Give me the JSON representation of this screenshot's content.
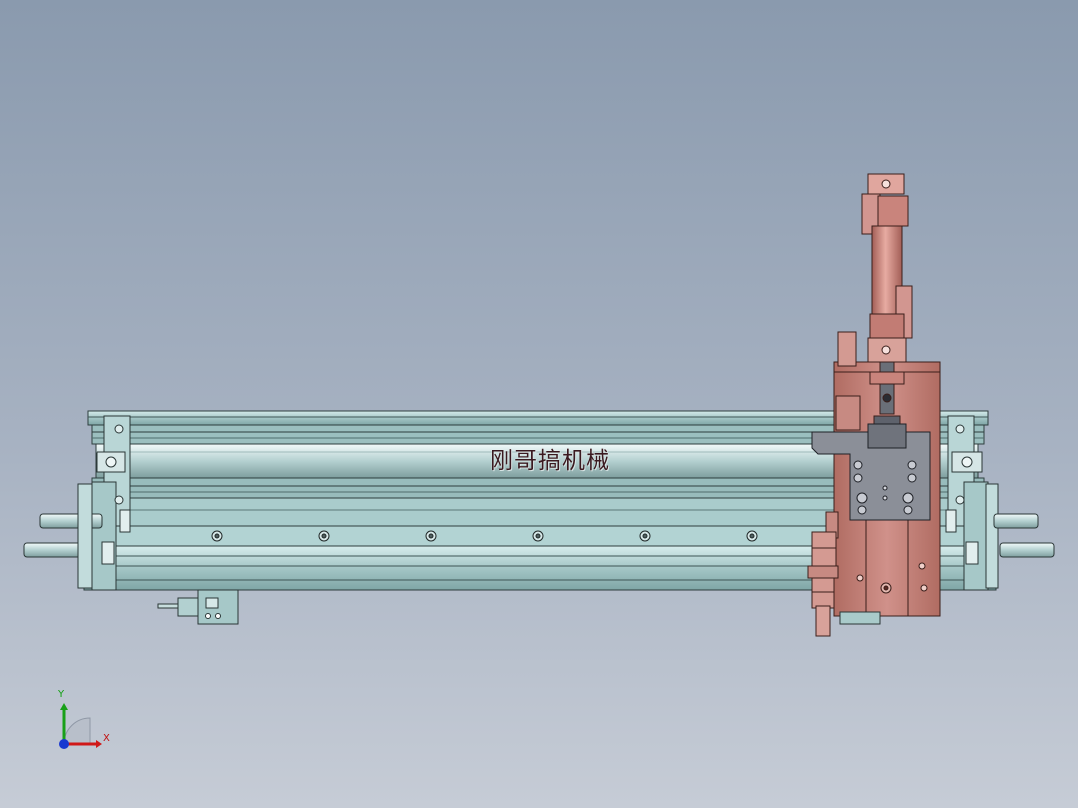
{
  "viewport": {
    "background_top": "#8a9aae",
    "background_bottom": "#c6ccd6"
  },
  "model": {
    "watermark": "刚哥搞机械",
    "colors": {
      "rail": "#a8cccc",
      "rail_dark": "#5f8787",
      "cylinder_body": "#c9847c",
      "carriage": "#bf7c72",
      "bracket_plate": "#8a8e97"
    }
  },
  "triad": {
    "x_label": "X",
    "y_label": "Y",
    "x_color": "#d01818",
    "y_color": "#18a018",
    "z_color": "#1838d0"
  }
}
